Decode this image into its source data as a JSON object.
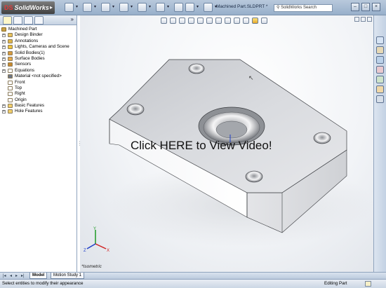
{
  "app": {
    "logo": "SolidWorks",
    "logo_mark": "DS"
  },
  "titlebar": {
    "document_title": "Machined Part.SLDPRT *",
    "search_placeholder": "SolidWorks Search"
  },
  "feature_tree": {
    "root": "Machined Part",
    "items": [
      {
        "label": "Design Binder",
        "expandable": true,
        "icon": "binder-icon"
      },
      {
        "label": "Annotations",
        "expandable": true,
        "icon": "annotations-icon"
      },
      {
        "label": "Lights, Cameras and Scene",
        "expandable": true,
        "icon": "lights-icon"
      },
      {
        "label": "Solid Bodies(1)",
        "expandable": true,
        "icon": "solid-bodies-icon"
      },
      {
        "label": "Surface Bodies",
        "expandable": true,
        "icon": "surface-bodies-icon"
      },
      {
        "label": "Sensors",
        "expandable": true,
        "icon": "sensors-icon"
      },
      {
        "label": "Equations",
        "expandable": true,
        "icon": "equations-icon"
      },
      {
        "label": "Material <not specified>",
        "expandable": false,
        "icon": "material-icon"
      },
      {
        "label": "Front",
        "expandable": false,
        "icon": "plane-icon"
      },
      {
        "label": "Top",
        "expandable": false,
        "icon": "plane-icon"
      },
      {
        "label": "Right",
        "expandable": false,
        "icon": "plane-icon"
      },
      {
        "label": "Origin",
        "expandable": false,
        "icon": "origin-icon"
      },
      {
        "label": "Basic Features",
        "expandable": true,
        "icon": "folder-icon"
      },
      {
        "label": "Hole Features",
        "expandable": true,
        "icon": "folder-icon"
      }
    ]
  },
  "bottom_tabs": {
    "model": "Model",
    "motion_study": "Motion Study 1"
  },
  "viewport": {
    "overlay_text": "Click HERE to View Video!",
    "view_label": "*Isometric",
    "axes": {
      "x": "X",
      "y": "Y",
      "z": "Z"
    }
  },
  "statusbar": {
    "message": "Select entities to modify their appearance",
    "mode": "Editing Part"
  },
  "colors": {
    "part_face": "#d7d9de",
    "part_side": "#ffffff",
    "chrome": "#b9c9dc",
    "triad_x": "#d01f1f",
    "triad_y": "#1d9a23",
    "triad_z": "#1f3fc8"
  }
}
